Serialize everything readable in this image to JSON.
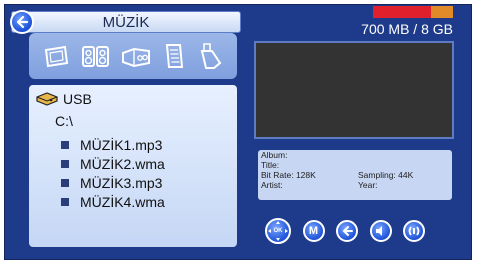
{
  "header": {
    "title": "MÜZİK"
  },
  "storage": {
    "text": "700 MB / 8 GB",
    "used_fraction": 0.72,
    "colors": {
      "used": "#e0202a",
      "free": "#e18a2a"
    }
  },
  "icons": [
    "photo-icon",
    "speaker-icon",
    "music-box-icon",
    "document-icon",
    "usb-stick-icon"
  ],
  "browser": {
    "device": "USB",
    "path": "C:\\",
    "files": [
      "MÜZİK1.mp3",
      "MÜZİK2.wma",
      "MÜZİK3.mp3",
      "MÜZİK4.wma"
    ]
  },
  "info": {
    "album_label": "Album:",
    "title_label": "Title:",
    "bitrate_label": "Bit Rate: 128K",
    "sampling_label": "Sampling: 44K",
    "artist_label": "Artist:",
    "year_label": "Year:"
  },
  "controls": {
    "ok": "OK",
    "menu": "M"
  },
  "colors": {
    "background": "#1e3a8a",
    "panel": "#c7d6f2",
    "accent": "#1f53d8"
  }
}
